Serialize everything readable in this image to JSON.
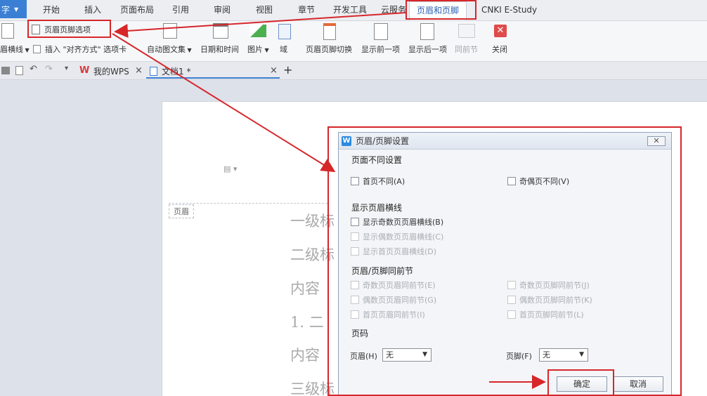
{
  "menubar": {
    "app_label": "字",
    "items": [
      "开始",
      "插入",
      "页面布局",
      "引用",
      "审阅",
      "视图",
      "章节",
      "开发工具",
      "云服务",
      "页眉和页脚",
      "CNKI E-Study"
    ]
  },
  "ribbon": {
    "option_button": "页眉页脚选项",
    "hline_label": "眉横线",
    "insert_align": "插入 \"对齐方式\" 选项卡",
    "auto_text": "自动图文集",
    "datetime": "日期和时间",
    "picture": "图片",
    "field": "域",
    "switch": "页眉页脚切换",
    "show_prev": "显示前一项",
    "show_next": "显示后一项",
    "same_prev": "同前节",
    "close": "关闭"
  },
  "tabs": {
    "my_wps": "我的WPS",
    "doc": "文档1 *",
    "add": "+"
  },
  "document": {
    "header_marker": "页眉",
    "lines": [
      "一级标",
      "二级标",
      "内容",
      "1.   二",
      "内容",
      "三级标"
    ]
  },
  "dialog": {
    "title": "页眉/页脚设置",
    "close_label": "✕",
    "section_diff": "页面不同设置",
    "first_page_diff": "首页不同(A)",
    "odd_even_diff": "奇偶页不同(V)",
    "section_hline": "显示页眉横线",
    "odd_hline": "显示奇数页页眉横线(B)",
    "even_hline": "显示偶数页页眉横线(C)",
    "first_hline": "显示首页页眉横线(D)",
    "section_same": "页眉/页脚同前节",
    "odd_header_same": "奇数页页眉同前节(E)",
    "odd_footer_same": "奇数页页脚同前节(J)",
    "even_header_same": "偶数页页眉同前节(G)",
    "even_footer_same": "偶数页页脚同前节(K)",
    "first_header_same": "首页页眉同前节(I)",
    "first_footer_same": "首页页脚同前节(L)",
    "section_pagenum": "页码",
    "header_label": "页眉(H)",
    "header_value": "无",
    "footer_label": "页脚(F)",
    "footer_value": "无",
    "ok": "确定",
    "cancel": "取消"
  },
  "colors": {
    "accent": "#3b7fd4",
    "annotation": "#d6262a"
  }
}
